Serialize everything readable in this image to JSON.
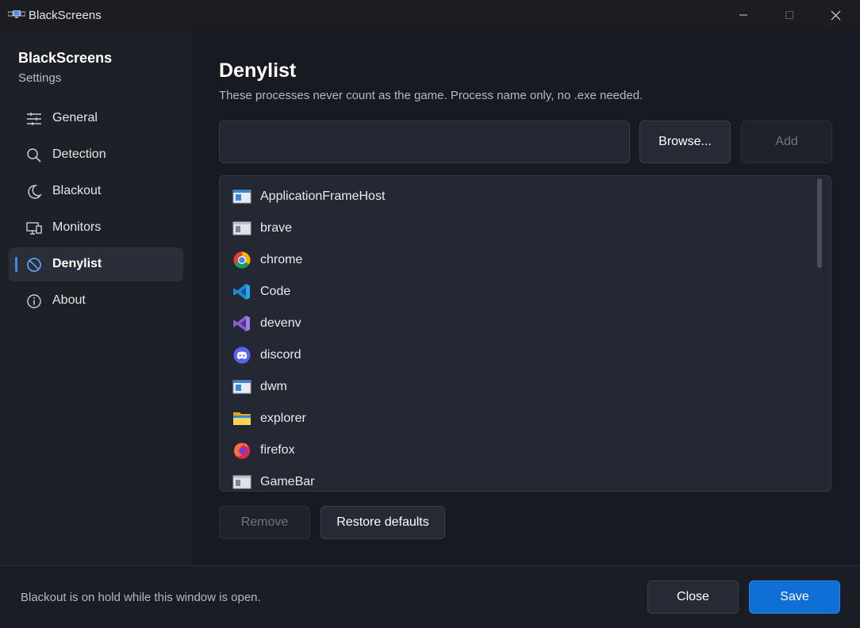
{
  "window": {
    "title": "BlackScreens",
    "app_icon": "monitors-icon",
    "controls": [
      "minimize-icon",
      "maximize-icon",
      "close-icon"
    ]
  },
  "sidebar": {
    "title": "BlackScreens",
    "subtitle": "Settings",
    "items": [
      {
        "label": "General",
        "icon": "sliders-icon",
        "active": false
      },
      {
        "label": "Detection",
        "icon": "search-icon",
        "active": false
      },
      {
        "label": "Blackout",
        "icon": "moon-icon",
        "active": false
      },
      {
        "label": "Monitors",
        "icon": "monitor-icon",
        "active": false
      },
      {
        "label": "Denylist",
        "icon": "block-icon",
        "active": true
      },
      {
        "label": "About",
        "icon": "info-icon",
        "active": false
      }
    ]
  },
  "main": {
    "title": "Denylist",
    "description": "These processes never count as the game. Process name only, no .exe needed.",
    "input": {
      "value": "",
      "placeholder": ""
    },
    "browse_label": "Browse...",
    "add_label": "Add",
    "processes": [
      {
        "name": "ApplicationFrameHost",
        "icon": "window-app-icon"
      },
      {
        "name": "brave",
        "icon": "generic-app-icon"
      },
      {
        "name": "chrome",
        "icon": "chrome-icon"
      },
      {
        "name": "Code",
        "icon": "vscode-icon"
      },
      {
        "name": "devenv",
        "icon": "visual-studio-icon"
      },
      {
        "name": "discord",
        "icon": "discord-icon"
      },
      {
        "name": "dwm",
        "icon": "window-app-icon"
      },
      {
        "name": "explorer",
        "icon": "folder-icon"
      },
      {
        "name": "firefox",
        "icon": "firefox-icon"
      },
      {
        "name": "GameBar",
        "icon": "generic-app-icon"
      }
    ],
    "remove_label": "Remove",
    "restore_label": "Restore defaults"
  },
  "footer": {
    "status": "Blackout is on hold while this window is open.",
    "close_label": "Close",
    "save_label": "Save"
  },
  "colors": {
    "accent": "#0f6fd4",
    "active_indicator": "#3b8be8",
    "background": "#171a21",
    "sidebar": "#1d2027"
  }
}
